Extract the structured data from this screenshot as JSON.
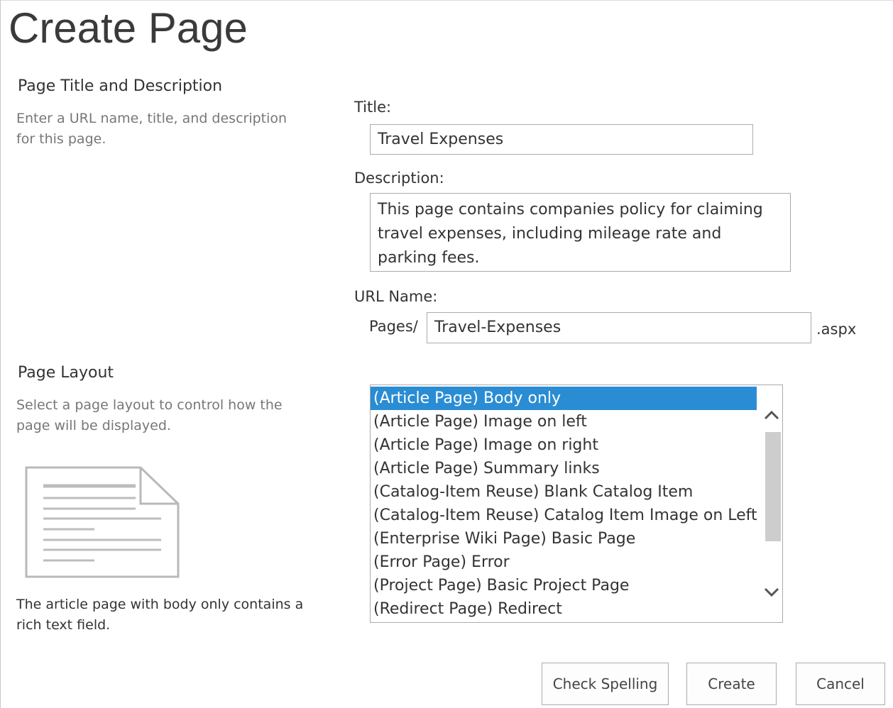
{
  "page": {
    "title": "Create Page"
  },
  "title_section": {
    "heading": "Page Title and Description",
    "description": "Enter a URL name, title, and description for this page."
  },
  "form": {
    "title_label": "Title:",
    "title_value": "Travel Expenses",
    "description_label": "Description:",
    "description_value": "This page contains companies policy for claiming travel expenses, including mileage rate and parking fees.",
    "url_label": "URL Name:",
    "url_prefix": "Pages/",
    "url_value": "Travel-Expenses",
    "url_suffix": ".aspx"
  },
  "layout_section": {
    "heading": "Page Layout",
    "description": "Select a page layout to control how the page will be displayed.",
    "preview_caption": "The article page with body only contains a rich text field.",
    "options": [
      "(Article Page) Body only",
      "(Article Page) Image on left",
      "(Article Page) Image on right",
      "(Article Page) Summary links",
      "(Catalog-Item Reuse) Blank Catalog Item",
      "(Catalog-Item Reuse) Catalog Item Image on Left",
      "(Enterprise Wiki Page) Basic Page",
      "(Error Page) Error",
      "(Project Page) Basic Project Page",
      "(Redirect Page) Redirect"
    ],
    "selected_option": "(Article Page) Body only"
  },
  "buttons": {
    "check_spelling": "Check Spelling",
    "create": "Create",
    "cancel": "Cancel"
  },
  "colors": {
    "selection": "#2a8dd4",
    "border": "#ababab",
    "muted_text": "#777777"
  }
}
